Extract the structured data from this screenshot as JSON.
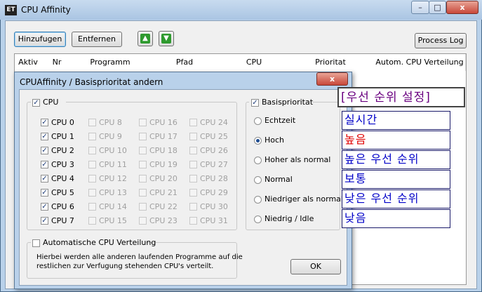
{
  "window": {
    "title": "CPU Affinity",
    "app_icon": "ET",
    "minimize": "–",
    "maximize": "□",
    "close": "x"
  },
  "toolbar": {
    "add": "Hinzufugen",
    "remove": "Entfernen",
    "up_icon": "arrow-up-icon",
    "down_icon": "arrow-down-icon",
    "process_log": "Process Log"
  },
  "columns": [
    "Aktiv",
    "Nr",
    "Programm",
    "Pfad",
    "CPU",
    "Prioritat",
    "Autom. CPU Verteilung"
  ],
  "dialog": {
    "title": "CPUAffinity / Basisprioritat andern",
    "close": "x",
    "cpu_group_label": "CPU",
    "cpu_col1": [
      {
        "label": "CPU 0",
        "checked": "✓"
      },
      {
        "label": "CPU 1",
        "checked": "✓"
      },
      {
        "label": "CPU 2",
        "checked": "✓"
      },
      {
        "label": "CPU 3",
        "checked": "✓"
      },
      {
        "label": "CPU 4",
        "checked": "✓"
      },
      {
        "label": "CPU 5",
        "checked": "✓"
      },
      {
        "label": "CPU 6",
        "checked": "✓"
      },
      {
        "label": "CPU 7",
        "checked": "✓"
      }
    ],
    "cpu_col2": [
      "CPU 8",
      "CPU 9",
      "CPU 10",
      "CPU 11",
      "CPU 12",
      "CPU 13",
      "CPU 14",
      "CPU 15"
    ],
    "cpu_col3": [
      "CPU 16",
      "CPU 17",
      "CPU 18",
      "CPU 19",
      "CPU 20",
      "CPU 21",
      "CPU 22",
      "CPU 23"
    ],
    "cpu_col4": [
      "CPU 24",
      "CPU 25",
      "CPU 26",
      "CPU 27",
      "CPU 28",
      "CPU 29",
      "CPU 30",
      "CPU 31"
    ],
    "prio_group_label": "Basisprioritat",
    "prio_options": [
      "Echtzeit",
      "Hoch",
      "Hoher als normal",
      "Normal",
      "Niedriger als normal",
      "Niedrig / Idle"
    ],
    "prio_selected": "Hoch",
    "auto_label": "Automatische CPU Verteilung",
    "auto_desc1": "Hierbei werden alle anderen laufenden Programme auf die",
    "auto_desc2": "restlichen zur Verfugung stehenden CPU's verteilt.",
    "ok": "OK"
  },
  "annotations": {
    "heading": "[우선 순위 설정]",
    "items": [
      "실시간",
      "높음",
      "높은 우선 순위",
      "보통",
      "낮은 우선 순위",
      "낮음"
    ],
    "heading_color": "#6a0080",
    "item_color": "#0000c8",
    "highlight_color": "#e00000"
  },
  "colors": {
    "frame": "#b9d1ea",
    "client": "#f0f0f0",
    "accent_green": "#2e9a2e"
  }
}
